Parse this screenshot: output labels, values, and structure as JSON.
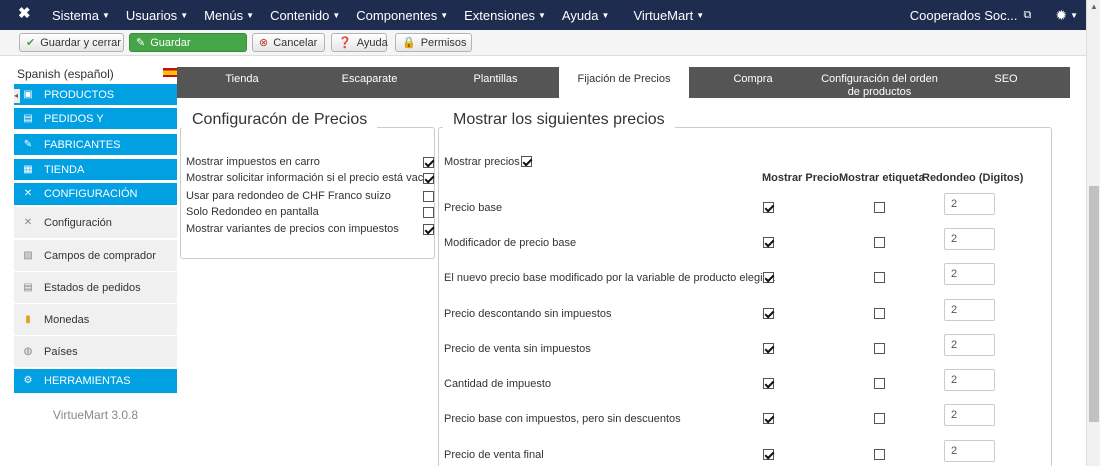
{
  "nav": {
    "logo": "✖",
    "menu": [
      {
        "label": "Sistema"
      },
      {
        "label": "Usuarios"
      },
      {
        "label": "Menús"
      },
      {
        "label": "Contenido"
      },
      {
        "label": "Componentes"
      },
      {
        "label": "Extensiones"
      },
      {
        "label": "Ayuda"
      },
      {
        "label": "VirtueMart"
      }
    ],
    "user": "Cooperados Soc..."
  },
  "toolbar": {
    "save_close": "Guardar y cerrar",
    "save": "Guardar",
    "cancel": "Cancelar",
    "help": "Ayuda",
    "permissions": "Permisos"
  },
  "sidebar": {
    "language": "Spanish (español)",
    "items": [
      {
        "label": "PRODUCTOS",
        "icon": "box-icon"
      },
      {
        "label": "PEDIDOS Y",
        "icon": "orders-icon"
      },
      {
        "label": "FABRICANTES",
        "icon": "wrench-icon"
      },
      {
        "label": "TIENDA",
        "icon": "store-icon"
      },
      {
        "label": "CONFIGURACIÓN",
        "icon": "config-icon"
      },
      {
        "label": "Configuración",
        "icon": "config-icon"
      },
      {
        "label": "Campos de comprador",
        "icon": "fields-icon"
      },
      {
        "label": "Estados de pedidos",
        "icon": "status-icon"
      },
      {
        "label": "Monedas",
        "icon": "coins-icon"
      },
      {
        "label": "Países",
        "icon": "globe-icon"
      },
      {
        "label": "HERRAMIENTAS",
        "icon": "tools-icon"
      }
    ],
    "version": "VirtueMart 3.0.8"
  },
  "tabs": [
    {
      "label": "Tienda"
    },
    {
      "label": "Escaparate"
    },
    {
      "label": "Plantillas"
    },
    {
      "label": "Fijación de Precios"
    },
    {
      "label": "Compra"
    },
    {
      "label": "Configuración del orden de productos"
    },
    {
      "label": "SEO"
    }
  ],
  "price_config": {
    "title": "Configuracón de Precios",
    "options": [
      {
        "label": "Mostrar impuestos en carro",
        "checked": true
      },
      {
        "label": "Mostrar solicitar información si el precio está vacío",
        "checked": true
      },
      {
        "label": "Usar para redondeo de CHF Franco suizo",
        "checked": false
      },
      {
        "label": "Solo Redondeo en pantalla",
        "checked": false
      },
      {
        "label": "Mostrar variantes de precios con impuestos",
        "checked": true
      }
    ]
  },
  "show_prices": {
    "title": "Mostrar los siguientes precios",
    "toggle_label": "Mostrar precios",
    "toggle_checked": true,
    "columns": [
      "Mostrar Precio",
      "Mostrar etiqueta",
      "Redondeo (Digitos)"
    ],
    "rows": [
      {
        "label": "Precio base",
        "show": true,
        "tag": false,
        "round": "2"
      },
      {
        "label": "Modificador de precio base",
        "show": true,
        "tag": false,
        "round": "2"
      },
      {
        "label": "El nuevo precio base modificado por la variable de producto elegida",
        "show": true,
        "tag": false,
        "round": "2"
      },
      {
        "label": "Precio descontando sin impuestos",
        "show": true,
        "tag": false,
        "round": "2"
      },
      {
        "label": "Precio de venta sin impuestos",
        "show": true,
        "tag": false,
        "round": "2"
      },
      {
        "label": "Cantidad de impuesto",
        "show": true,
        "tag": false,
        "round": "2"
      },
      {
        "label": "Precio base con impuestos, pero sin descuentos",
        "show": true,
        "tag": false,
        "round": "2"
      },
      {
        "label": "Precio de venta final",
        "show": true,
        "tag": false,
        "round": "2"
      }
    ]
  }
}
